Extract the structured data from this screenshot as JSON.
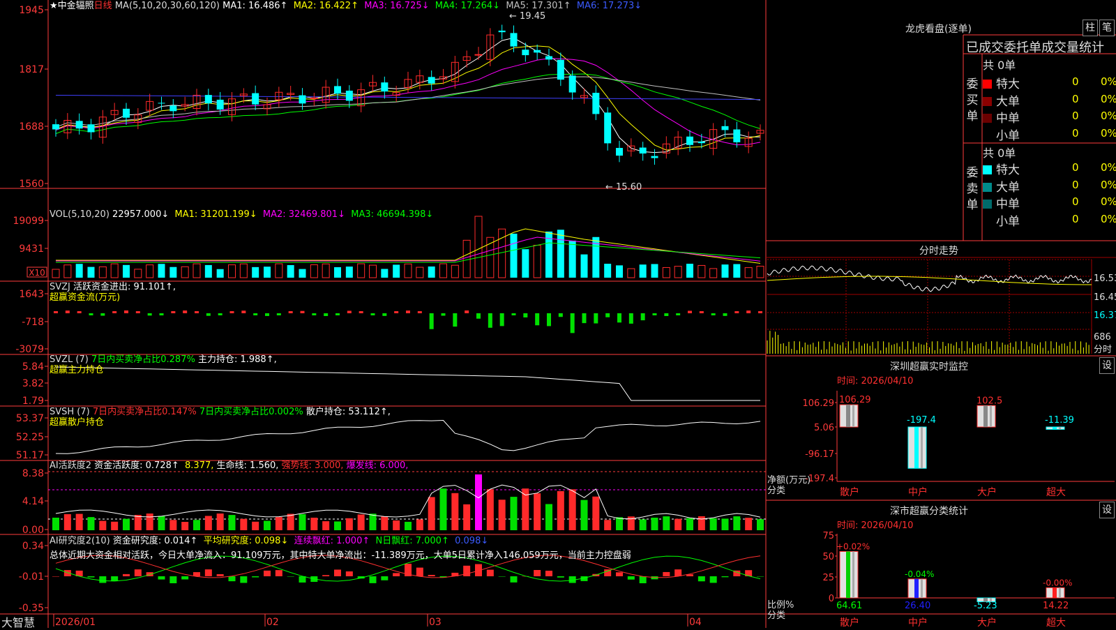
{
  "colors": {
    "up": "#ff2a2a",
    "down": "#00ffff",
    "bg": "#000000",
    "grid": "#a00000",
    "axis": "#ff3b3b",
    "ma1": "#ffffff",
    "ma2": "#ffff00",
    "ma3": "#ff00ff",
    "ma4": "#00ff00",
    "ma5": "#c0c0c0",
    "ma6": "#4040ff",
    "green": "#00e000",
    "magenta": "#ff00ff"
  },
  "stock": {
    "star": "★",
    "name": "中金辐照",
    "period": "日线",
    "brand": "大智慧"
  },
  "main_chart": {
    "header": {
      "ma_label": "MA(5,10,20,30,60,120)",
      "ma1": "MA1: 16.486↑",
      "ma2": "MA2: 16.422↑",
      "ma3": "MA3: 16.725↓",
      "ma4": "MA4: 17.264↓",
      "ma5": "MA5: 17.301↑",
      "ma6": "MA6: 17.273↓"
    },
    "yticks": [
      "1945",
      "1817",
      "1688",
      "1560"
    ],
    "high_label": "19.45",
    "low_label": "15.60"
  },
  "volume": {
    "header": {
      "label": "VOL(5,10,20)",
      "v": "22957.000↓",
      "ma1": "MA1: 31201.199↓",
      "ma2": "MA2: 32469.801↓",
      "ma3": "MA3: 46694.398↓"
    },
    "yticks": [
      "19099",
      "9431"
    ],
    "unit": "X10"
  },
  "svzj": {
    "header": {
      "name": "SVZJ",
      "text": "活跃资金进出: 91.101↑,",
      "sub": "超赢资金流(万元)"
    },
    "yticks": [
      "1643",
      "-718",
      "-3079"
    ]
  },
  "svzl": {
    "header": {
      "name": "SVZL (7)",
      "t1": "7日内买卖净占比0.287%",
      "t2": "主力持仓: 1.988↑,",
      "sub": "超赢主力持仓"
    },
    "yticks": [
      "5.84",
      "3.82",
      "1.79"
    ]
  },
  "svsh": {
    "header": {
      "name": "SVSH (7)",
      "t1": "7日内买卖净占比0.147%",
      "t2": "7日内买卖净占比0.002%",
      "t3": "散户持仓: 53.112↑,",
      "sub": "超赢散户持仓"
    },
    "yticks": [
      "53.37",
      "52.25",
      "51.17"
    ]
  },
  "ai_active": {
    "header": {
      "name": "AI活跃度2",
      "t1": "资金活跃度: 0.728↑",
      "t2": "8.377,",
      "t3": "生命线: 1.560,",
      "t4": "强势线: 3.000,",
      "t5": "爆发线: 6.000,"
    },
    "yticks": [
      "8.38",
      "4.14",
      "0.00"
    ]
  },
  "ai_research": {
    "header": {
      "name": "AI研究度2(10)",
      "t1": "资金研究度: 0.014↑",
      "t2": "平均研究度: 0.098↓",
      "t3": "连续飘红: 1.000↑",
      "t4": "N日飘红: 7.000↑",
      "t5": "0.098↓"
    },
    "summary": "总体近期大资金相对活跃，今日大单净流入：91.109万元，其中特大单净流出：-11.389万元，大单5日累计净入146.059万元，当前主力控盘弱",
    "yticks": [
      "0.34",
      "-0.01",
      "-0.35"
    ]
  },
  "xaxis": [
    "2026/01",
    "02",
    "03",
    "04"
  ],
  "dragon": {
    "title": "龙虎看盘(逐单)",
    "btn_bar": "柱",
    "btn_pen": "笔",
    "tabs": "已成交委托单成交量统计",
    "buy": {
      "label": "委买单",
      "total": "共 0单",
      "rows": [
        {
          "name": "特大",
          "count": "0",
          "pct": "0%",
          "color": "#ff0000"
        },
        {
          "name": "大单",
          "count": "0",
          "pct": "0%",
          "color": "#8b0000"
        },
        {
          "name": "中单",
          "count": "0",
          "pct": "0%",
          "color": "#6b0000"
        },
        {
          "name": "小单",
          "count": "0",
          "pct": "0%",
          "color": ""
        }
      ]
    },
    "sell": {
      "label": "委卖单",
      "total": "共 0单",
      "rows": [
        {
          "name": "特大",
          "count": "0",
          "pct": "0%",
          "color": "#00ffff"
        },
        {
          "name": "大单",
          "count": "0",
          "pct": "0%",
          "color": "#008b8b"
        },
        {
          "name": "中单",
          "count": "0",
          "pct": "0%",
          "color": "#006b6b"
        },
        {
          "name": "小单",
          "count": "0",
          "pct": "0%",
          "color": ""
        }
      ]
    }
  },
  "intraday": {
    "title": "分时走势",
    "yticks": [
      "16.53",
      "16.45",
      "16.37"
    ],
    "vol_label": "686",
    "vol_unit": "分时"
  },
  "monitor": {
    "title": "深圳超赢实时监控",
    "btn": "设",
    "time": "时间: 2026/04/10",
    "yticks": [
      "106.29",
      "5.06",
      "-96.17",
      "-197.4"
    ],
    "ylabel": "净额(万元)",
    "cat_label": "分类",
    "categories": [
      "散户",
      "中户",
      "大户",
      "超大"
    ],
    "values": [
      106.29,
      -197.4,
      102.5,
      -11.39
    ],
    "value_labels": [
      "106.29",
      "-197.4",
      "102.5",
      "-11.39"
    ]
  },
  "classify": {
    "title": "深市超赢分类统计",
    "btn": "设",
    "time": "时间: 2026/04/10",
    "yticks": [
      "75",
      "50",
      "25",
      "0"
    ],
    "ylabel": "比例%",
    "cat_label": "分类",
    "categories": [
      "散户",
      "中户",
      "大户",
      "超大"
    ],
    "values": [
      64.61,
      26.4,
      -5.23,
      14.22
    ],
    "value_labels": [
      "64.61",
      "26.40",
      "-5.23",
      "14.22"
    ],
    "top_labels": [
      "+0.02%",
      "-0.04%",
      "",
      "-0.00%"
    ]
  }
}
